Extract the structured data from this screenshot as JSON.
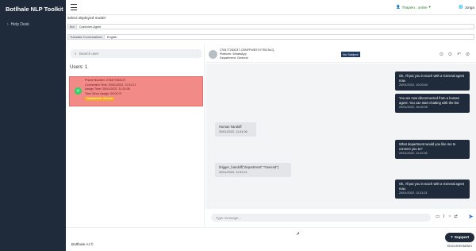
{
  "app": {
    "title": "Botlhale NLP Toolkit"
  },
  "sidebar": {
    "items": [
      {
        "label": "Help Desk",
        "icon": "chevron-right-icon"
      }
    ]
  },
  "topbar": {
    "user_status": "Thapelo : online",
    "language": "Jonga"
  },
  "deploy": {
    "label": "select deployed model",
    "bot_tag": "Bot",
    "bot_value": "Customer-Agent",
    "translate_tag": "Translate Conversations",
    "translate_value": "English"
  },
  "users": {
    "search_placeholder": "Search user",
    "title": "Users: 1",
    "card": {
      "phone": "Phone Number: 278477283237",
      "connection": "Connection Time: 20/01/2022, 11:31:21",
      "assign": "Assign Time: 20/01/2022, 11:31:08",
      "since_assign": "Time Since Assign: 00:02:07",
      "department": "Department: General"
    }
  },
  "chat": {
    "id": "278477283237-CBNFFWBTOYTBCNLQ",
    "platform": "Platform: WhatsApp",
    "department": "Department: General",
    "subject": "No Subject",
    "input_placeholder": "Type message...",
    "messages": [
      {
        "dir": "out",
        "text": "Ok, I'll put you in touch with a General agent now.",
        "time": "20/01/2022, 10:03:44"
      },
      {
        "dir": "out",
        "text": "You are now disconnected from a human agent. You can start chatting with the bot",
        "time": "20/01/2022, 10:04:09"
      },
      {
        "dir": "in",
        "text": "Human handoff",
        "time": "20/01/2022, 11:31:06"
      },
      {
        "dir": "out",
        "text": "What department would you like me to connect you to?",
        "time": "20/01/2022, 11:31:06"
      },
      {
        "dir": "in",
        "text": "/trigger_handoff{\"department\":\"General\"}",
        "time": "20/01/2022, 11:31:21"
      },
      {
        "dir": "out",
        "text": "Ok, I'll put you in touch with a General agent now.",
        "time": "20/01/2022, 11:31:21"
      }
    ]
  },
  "footer": {
    "powered": "Botlhale AI ©",
    "support": "Support",
    "docs": "Documentation"
  },
  "colors": {
    "sidebar": "#1f2a3a",
    "card": "#f28b88",
    "badge": "#f5a623",
    "send": "#2b6de1"
  }
}
